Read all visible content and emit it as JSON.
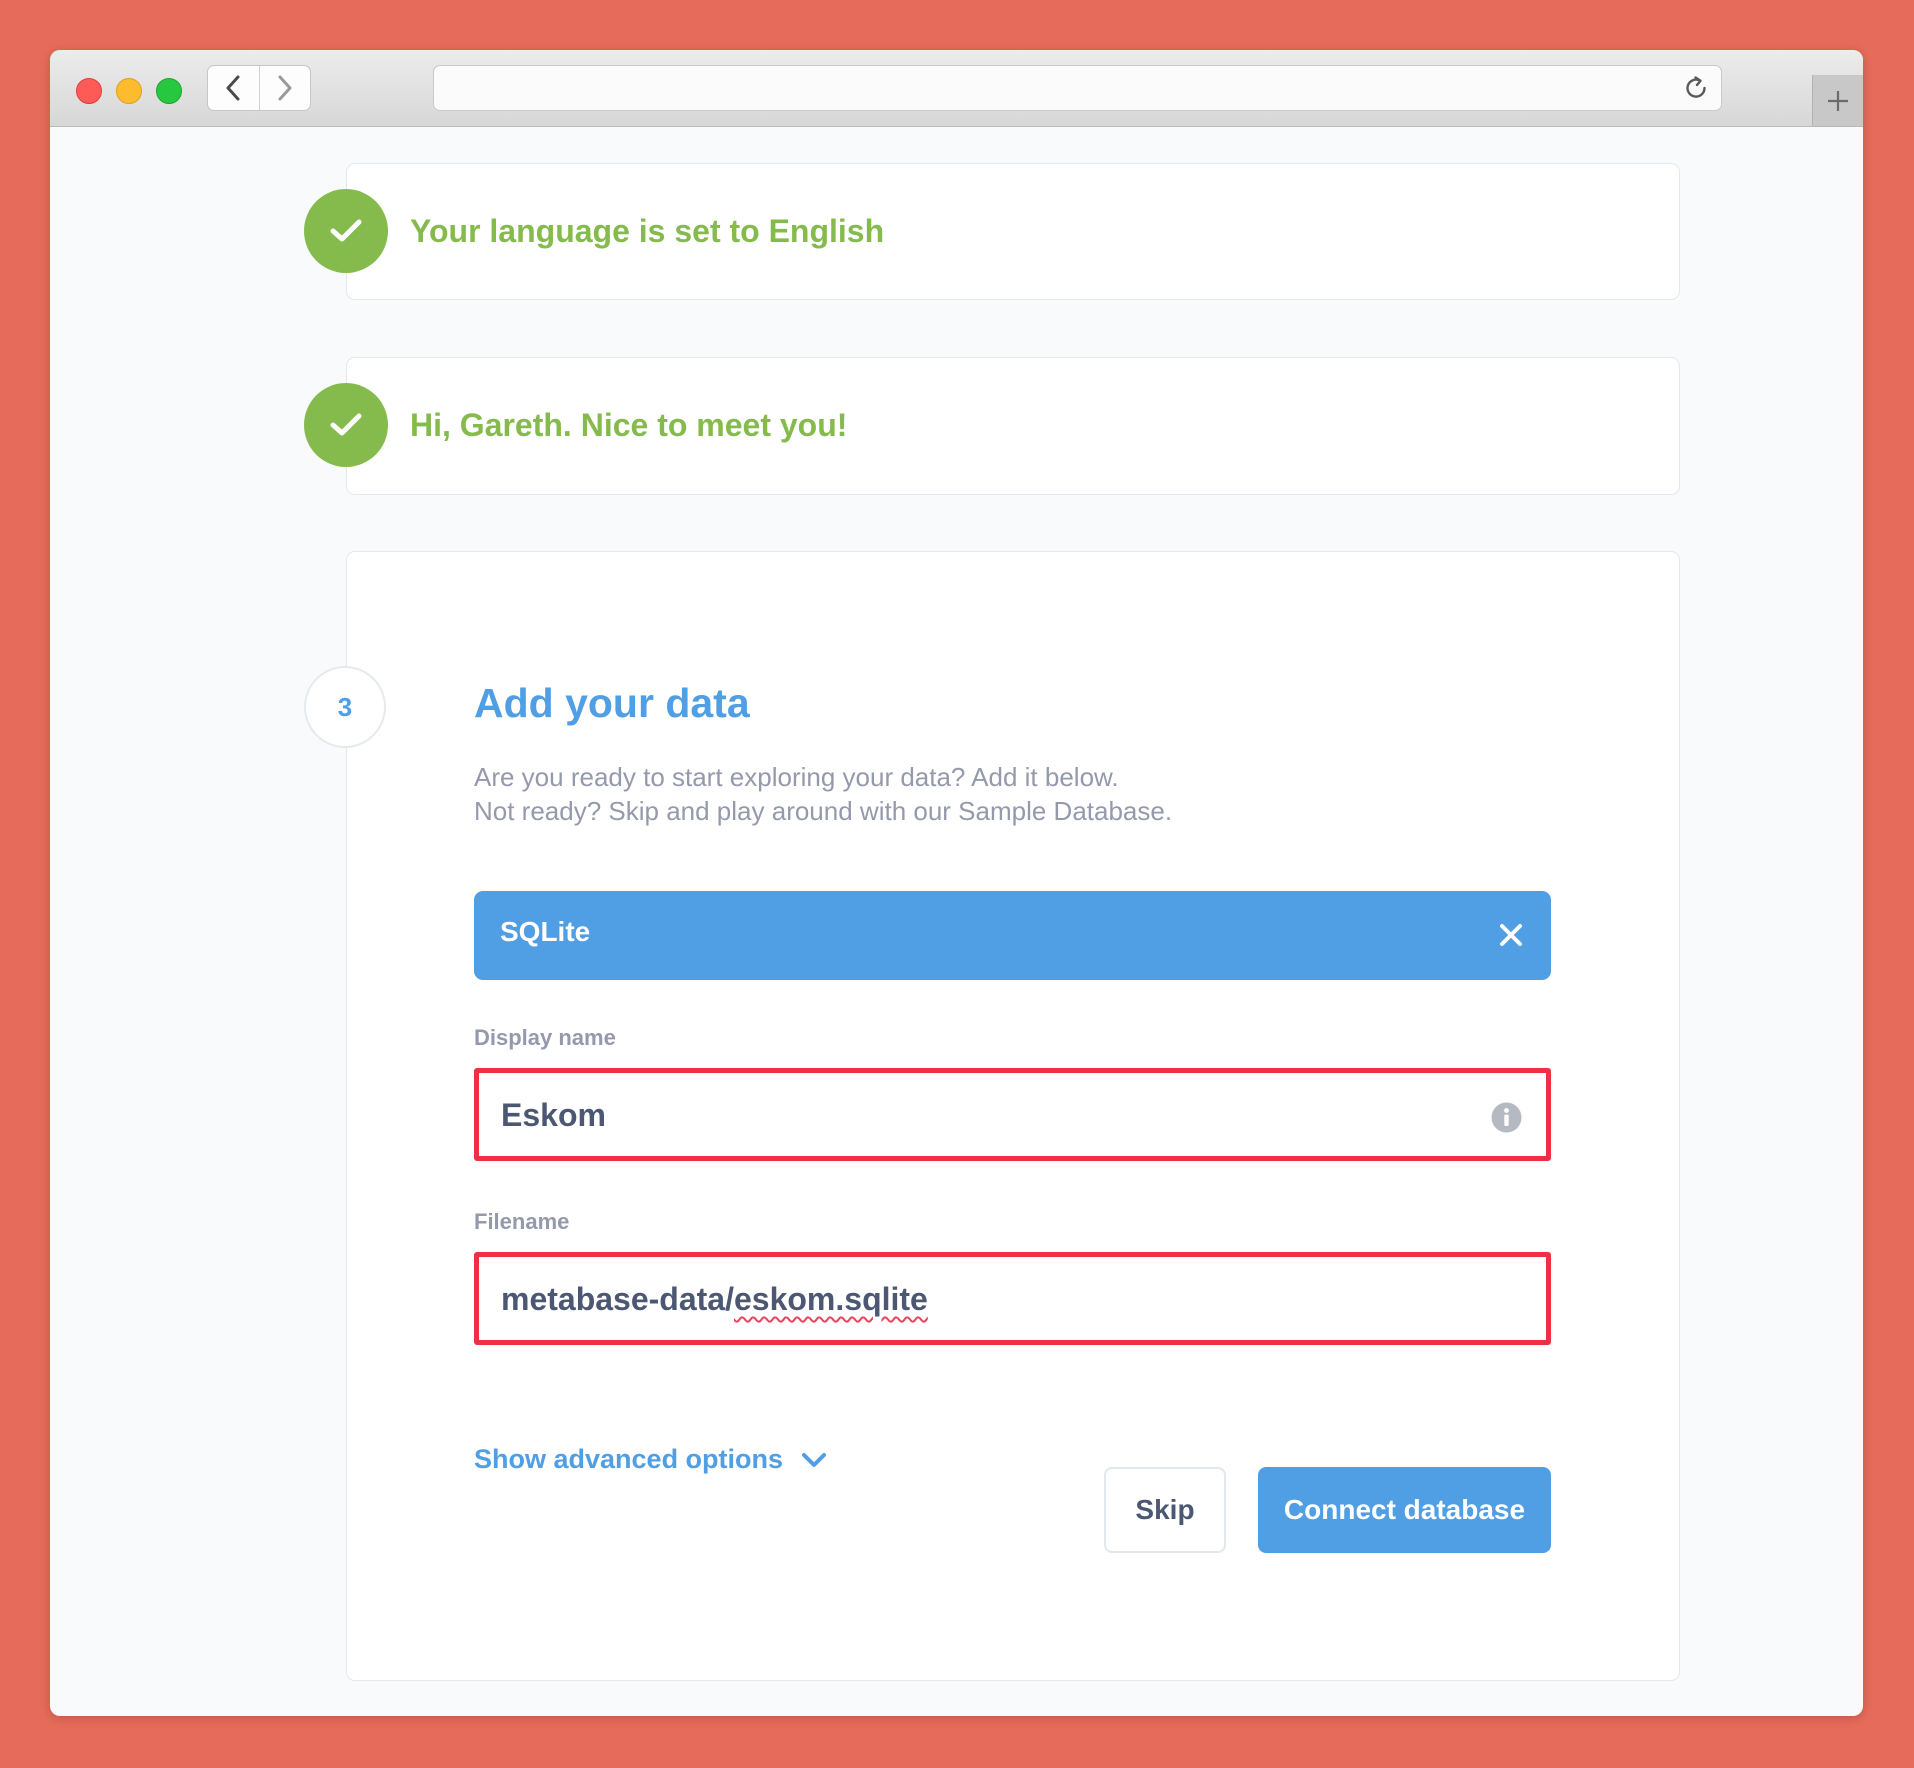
{
  "colors": {
    "brand": "#509ee3",
    "success": "#84bb4c",
    "highlight": "#ec3144",
    "muted_text": "#949aab",
    "dark_text": "#4c5773"
  },
  "steps": [
    {
      "status": "done",
      "icon": "checkmark-icon",
      "text": "Your language is set to English"
    },
    {
      "status": "done",
      "icon": "checkmark-icon",
      "text": "Hi, Gareth. Nice to meet you!"
    }
  ],
  "current_step": {
    "number": "3",
    "title": "Add your data",
    "description_line1": "Are you ready to start exploring your data? Add it below.",
    "description_line2": "Not ready? Skip and play around with our Sample Database.",
    "database": {
      "engine": "SQLite",
      "close_icon": "close-icon"
    },
    "fields": {
      "display_name": {
        "label": "Display name",
        "value": "Eskom",
        "icon": "info-icon"
      },
      "filename": {
        "label": "Filename",
        "value_prefix": "metabase-data/",
        "value_suffix": "eskom.sqlite"
      }
    },
    "advanced_label": "Show advanced options",
    "advanced_icon": "chevron-down-icon",
    "skip_label": "Skip",
    "connect_label": "Connect database"
  }
}
